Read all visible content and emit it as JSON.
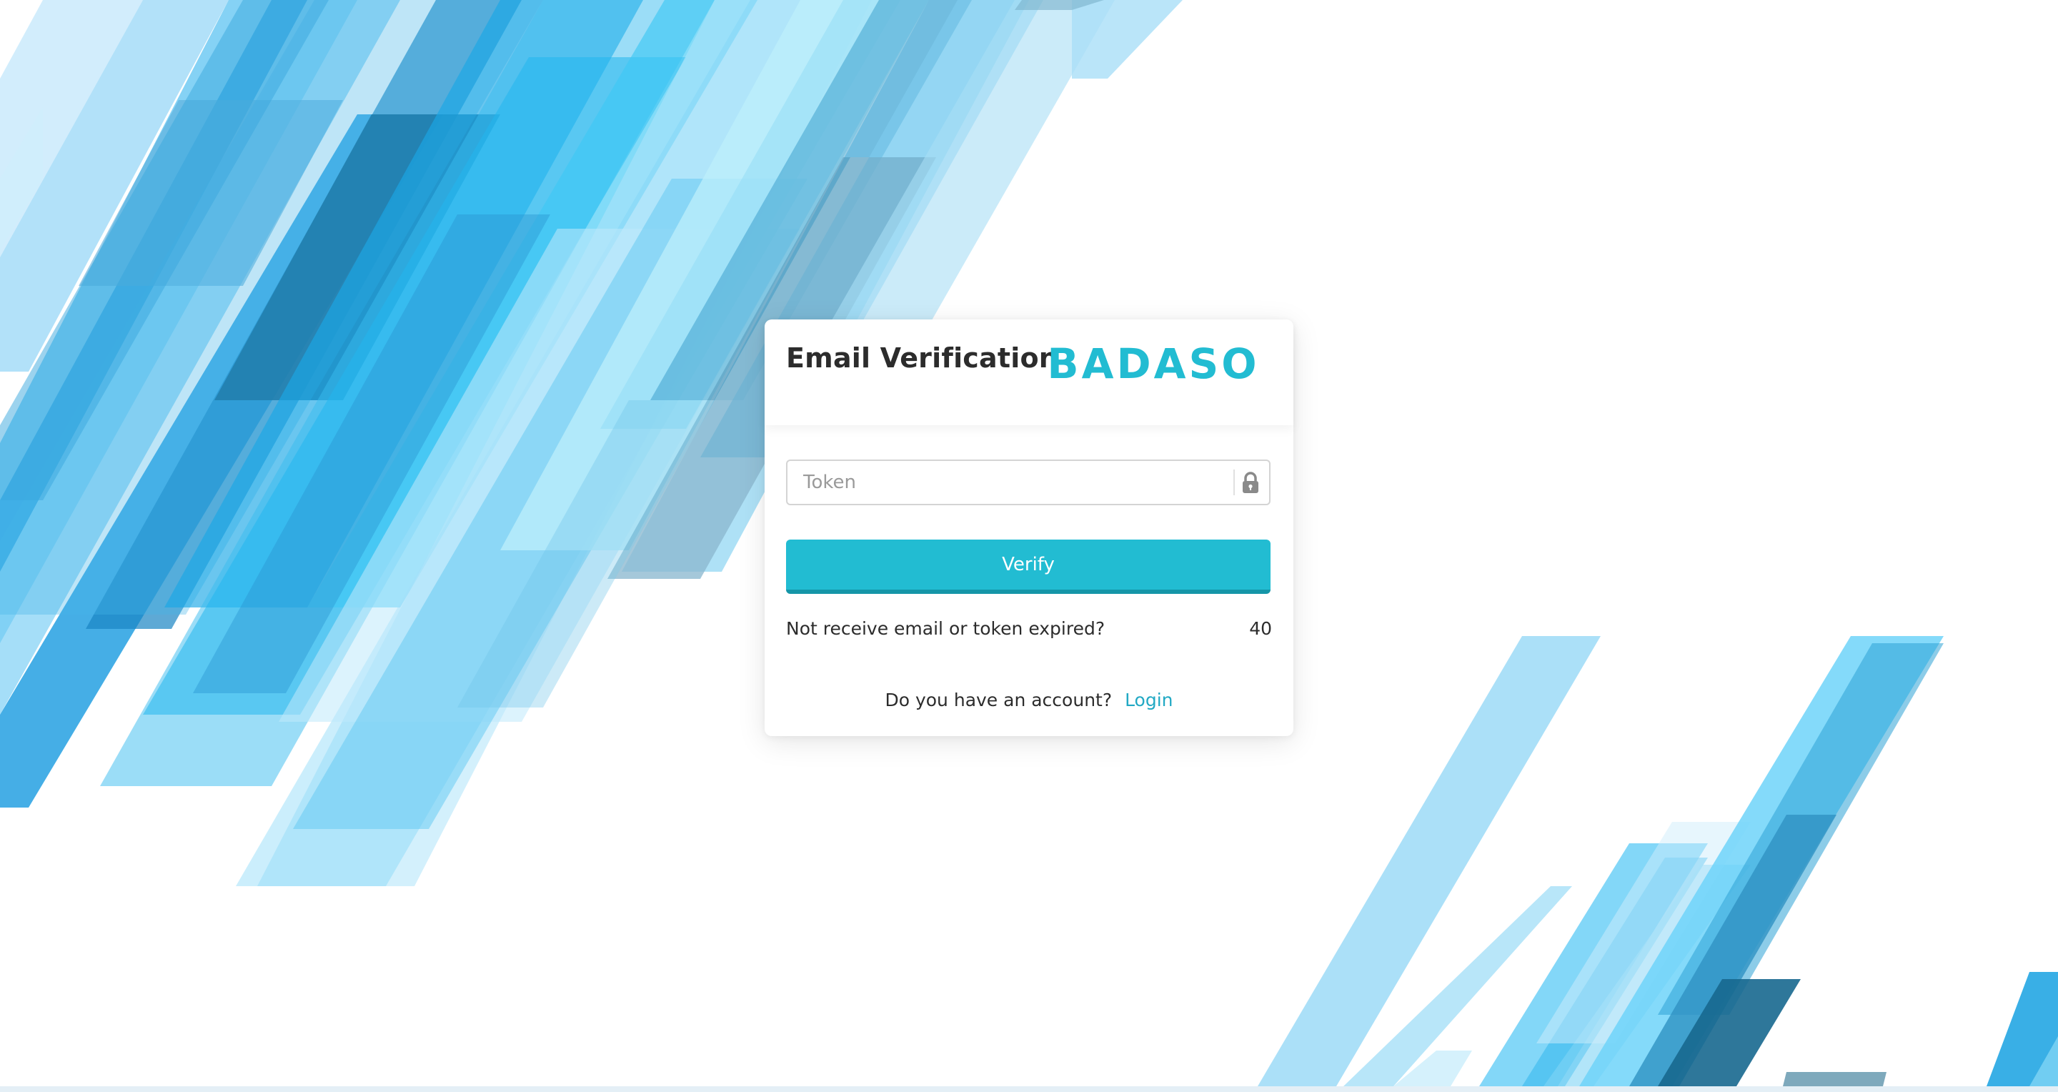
{
  "page": {
    "title": "Email Verification",
    "brand": "BADASO"
  },
  "form": {
    "token_placeholder": "Token",
    "token_value": "",
    "verify_label": "Verify",
    "resend_prompt": "Not receive email or token expired?",
    "countdown": "40",
    "account_prompt": "Do you have an account?",
    "login_label": "Login"
  },
  "icons": {
    "token_field": "lock-icon"
  },
  "colors": {
    "accent": "#22bcd2",
    "accent_dark": "#1596a8",
    "link": "#22a9c4",
    "text": "#2c2c2c",
    "placeholder": "#9a9a9a"
  }
}
